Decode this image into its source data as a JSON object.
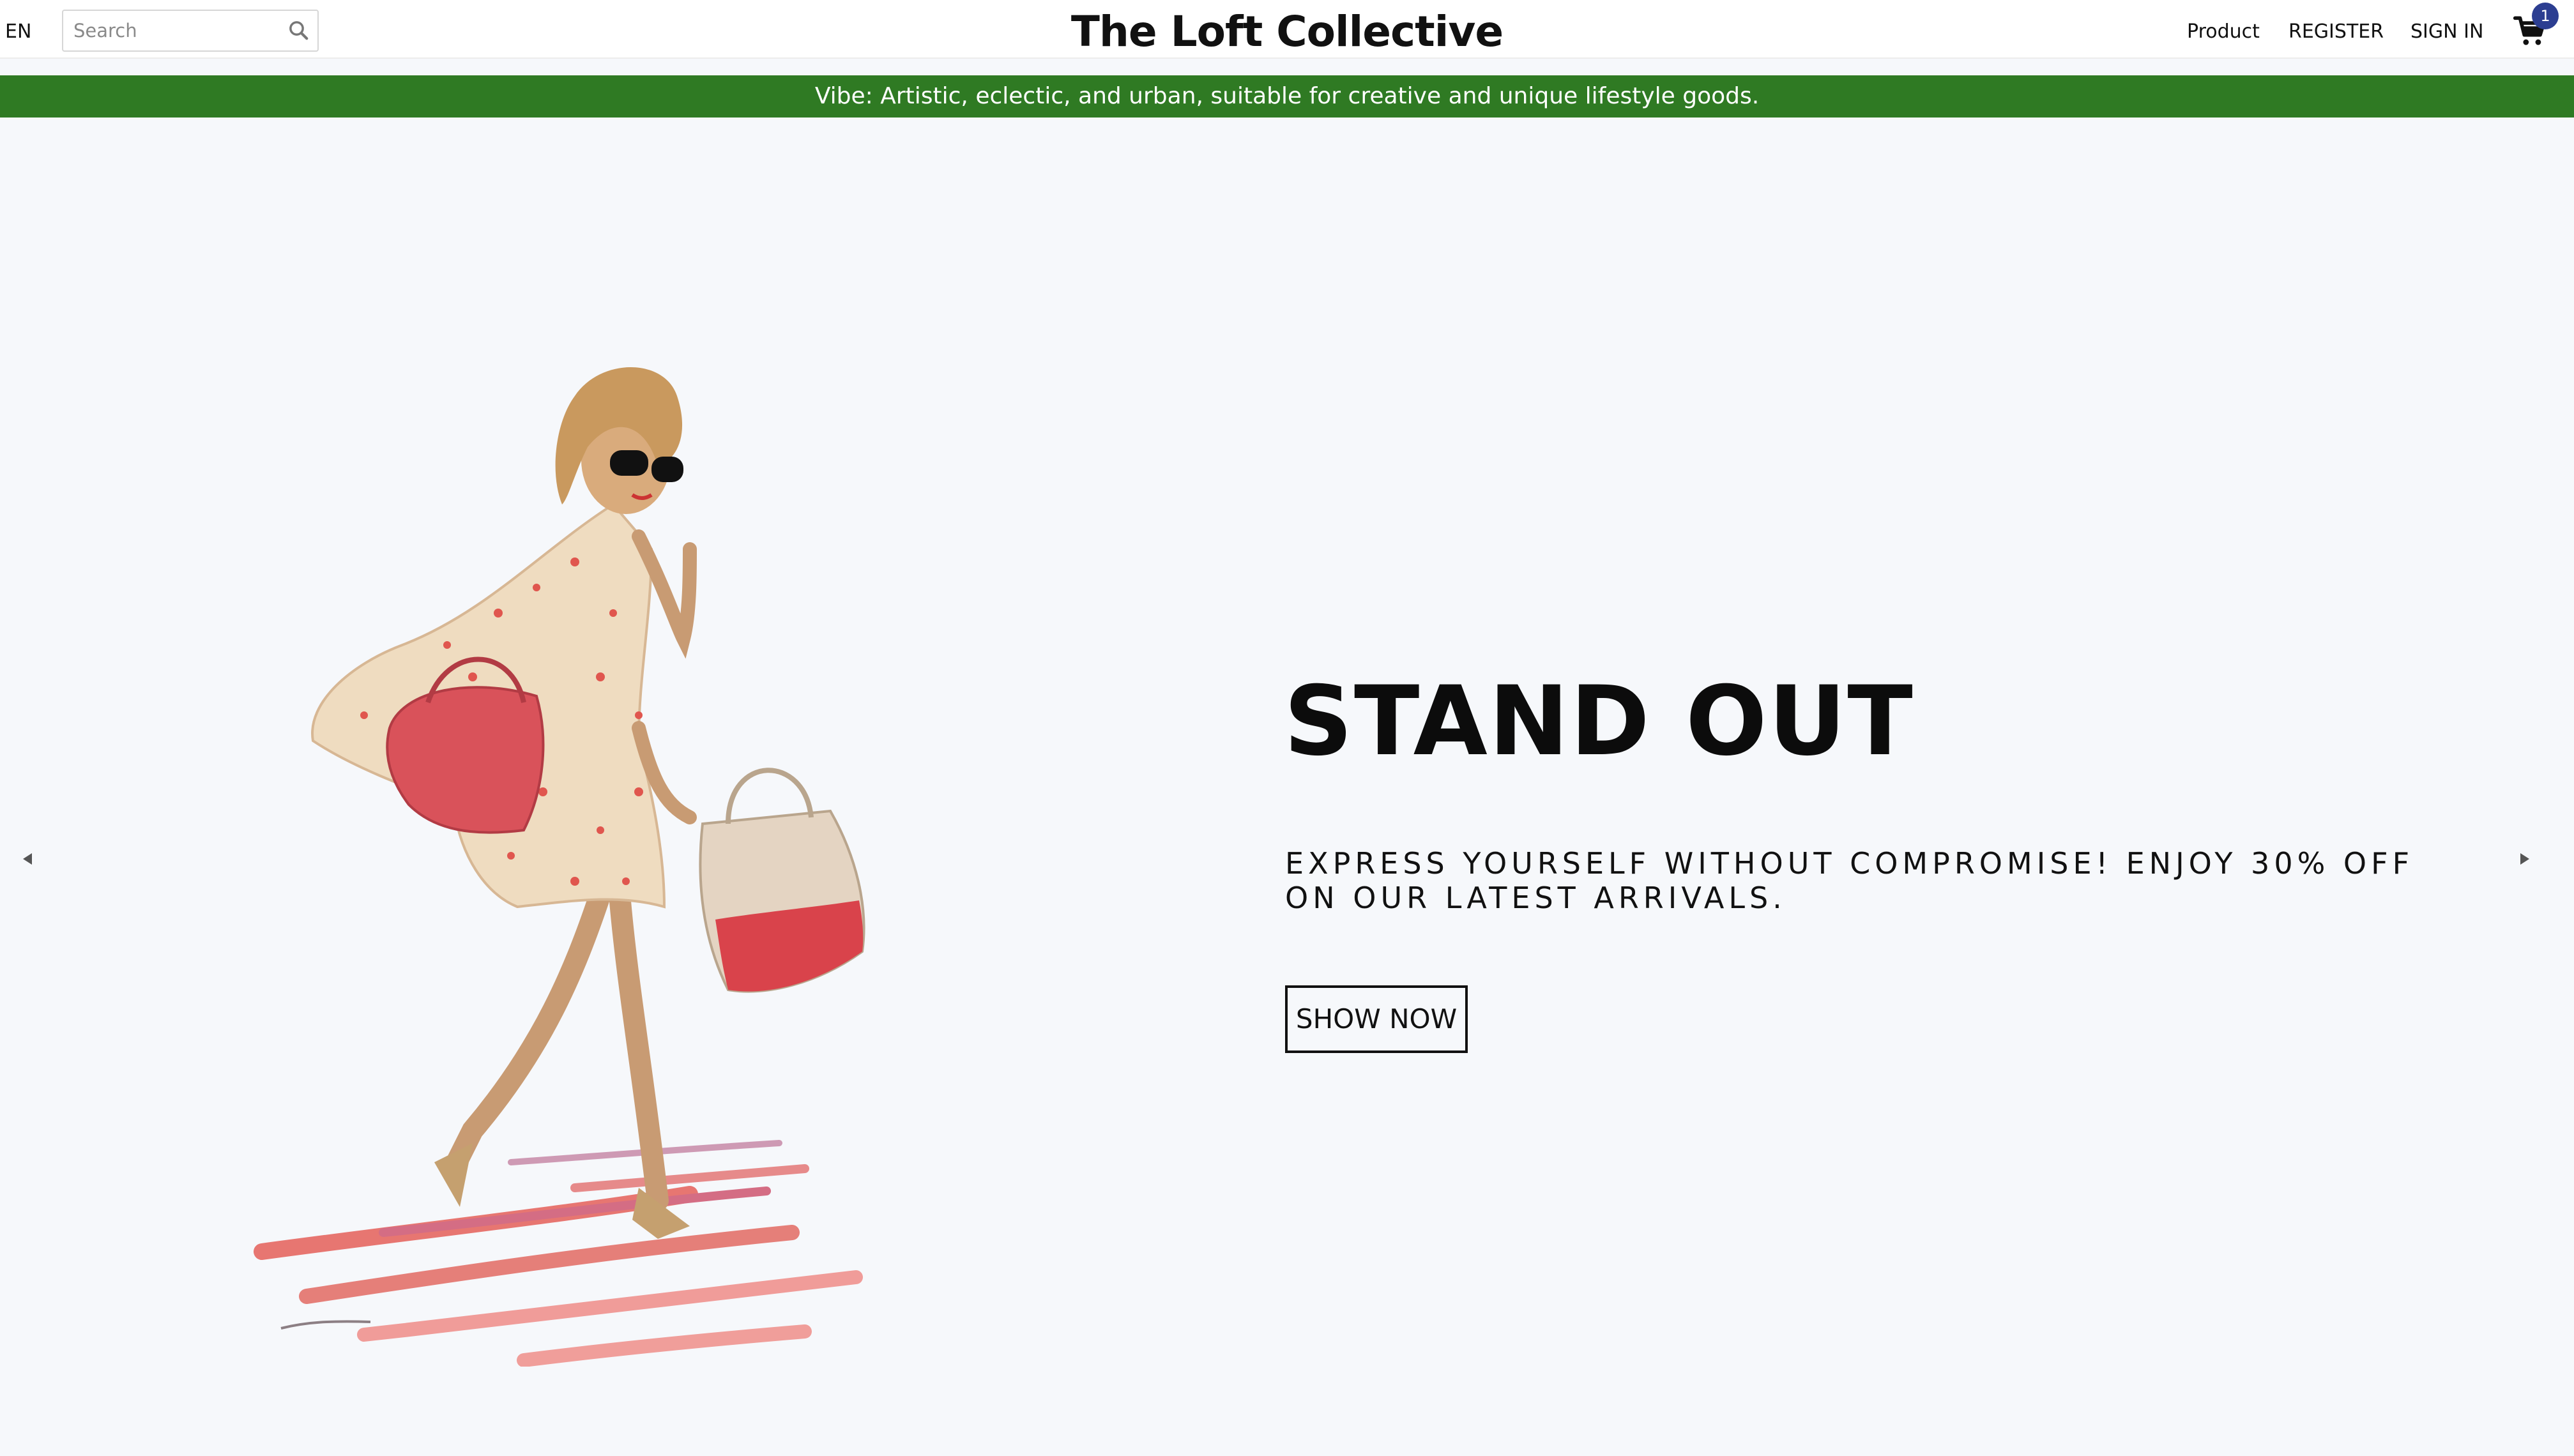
{
  "header": {
    "language": "EN",
    "search_placeholder": "Search",
    "brand": "The Loft Collective",
    "nav": {
      "product": "Product",
      "register": "REGISTER",
      "sign_in": "SIGN IN"
    },
    "cart_count": "1",
    "icons": {
      "search": "search-icon",
      "cart": "shopping-cart-icon"
    }
  },
  "banner": {
    "text": "Vibe: Artistic, eclectic, and urban, suitable for creative and unique lifestyle goods."
  },
  "hero": {
    "title": "STAND OUT",
    "subtitle": "EXPRESS YOURSELF WITHOUT COMPROMISE! ENJOY 30% OFF ON OUR LATEST ARRIVALS.",
    "button_label": "SHOW NOW",
    "illustration": "fashion-illustration-woman-with-handbags",
    "prev_icon": "caret-left-icon",
    "next_icon": "caret-right-icon"
  },
  "colors": {
    "banner_bg": "#2f7a23",
    "page_bg": "#f6f8fb",
    "cart_badge": "#2c3e91"
  }
}
